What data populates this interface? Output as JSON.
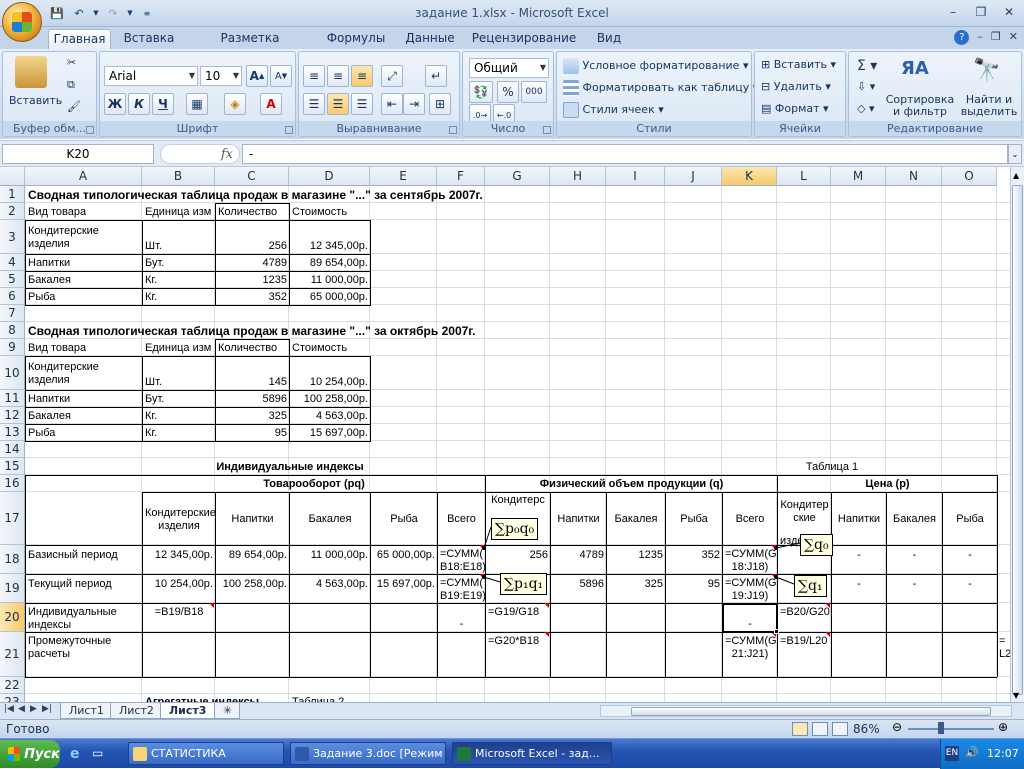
{
  "window": {
    "title": "задание 1.xlsx - Microsoft Excel"
  },
  "ribbon_tabs": [
    "Главная",
    "Вставка",
    "Разметка страницы",
    "Формулы",
    "Данные",
    "Рецензирование",
    "Вид"
  ],
  "ribbon": {
    "clipboard": {
      "paste": "Вставить",
      "label": "Буфер обм..."
    },
    "font": {
      "name": "Arial",
      "size": "10",
      "label": "Шрифт",
      "bold": "Ж",
      "italic": "К",
      "underline": "Ч"
    },
    "alignment": {
      "label": "Выравнивание"
    },
    "number": {
      "format": "Общий",
      "percent": "%",
      "thousands": "000",
      "label": "Число"
    },
    "styles": {
      "conditional": "Условное форматирование",
      "format_table": "Форматировать как таблицу",
      "cell_styles": "Стили ячеек",
      "label": "Стили"
    },
    "cells": {
      "insert": "Вставить",
      "delete": "Удалить",
      "format": "Формат",
      "label": "Ячейки"
    },
    "editing": {
      "sort": "Сортировка и фильтр",
      "find": "Найти и выделить",
      "label": "Редактирование"
    }
  },
  "formula_bar": {
    "name_box": "K20",
    "fx": "fx",
    "formula": "-"
  },
  "columns": [
    "A",
    "B",
    "C",
    "D",
    "E",
    "F",
    "G",
    "H",
    "I",
    "J",
    "K",
    "L",
    "M",
    "N",
    "O"
  ],
  "rows": [
    "1",
    "2",
    "3",
    "4",
    "5",
    "6",
    "7",
    "8",
    "9",
    "10",
    "11",
    "12",
    "13",
    "14",
    "15",
    "16",
    "17",
    "18",
    "19",
    "20",
    "21",
    "22",
    "23"
  ],
  "table_sep": {
    "title": "Сводная типологическая таблица продаж в магазине \"...\" за сентябрь 2007г.",
    "headers": [
      "Вид товара",
      "Единица изм",
      "Количество",
      "Стоимость"
    ],
    "rows": [
      {
        "name1": "Кондитерские",
        "name2": "изделия",
        "unit": "Шт.",
        "qty": "256",
        "cost": "12 345,00р."
      },
      {
        "name": "Напитки",
        "unit": "Бут.",
        "qty": "4789",
        "cost": "89 654,00р."
      },
      {
        "name": "Бакалея",
        "unit": "Кг.",
        "qty": "1235",
        "cost": "11 000,00р."
      },
      {
        "name": "Рыба",
        "unit": "Кг.",
        "qty": "352",
        "cost": "65 000,00р."
      }
    ]
  },
  "table_oct": {
    "title": "Сводная типологическая таблица продаж в магазине \"...\" за октябрь 2007г.",
    "headers": [
      "Вид товара",
      "Единица изм",
      "Количество",
      "Стоимость"
    ],
    "rows": [
      {
        "name1": "Кондитерские",
        "name2": "изделия",
        "unit": "Шт.",
        "qty": "145",
        "cost": "10 254,00р."
      },
      {
        "name": "Напитки",
        "unit": "Бут.",
        "qty": "5896",
        "cost": "100 258,00р."
      },
      {
        "name": "Бакалея",
        "unit": "Кг.",
        "qty": "325",
        "cost": "4 563,00р."
      },
      {
        "name": "Рыба",
        "unit": "Кг.",
        "qty": "95",
        "cost": "15 697,00р."
      }
    ]
  },
  "index_table": {
    "title": "Индивидуальные индексы",
    "table1": "Таблица 1",
    "turnover": "Товарооборот (pq)",
    "volume": "Физический объем продукции (q)",
    "price": "Цена (p)",
    "h17": {
      "b": "Кондитерские изделия",
      "c": "Напитки",
      "d": "Бакалея",
      "e": "Рыба",
      "f": "Всего",
      "g": "Кондитерс",
      "h": "Напитки",
      "i": "Бакалея",
      "j": "Рыба",
      "k": "Всего",
      "l": "Кондитерские",
      "m": "Напитки",
      "n": "Бакалея",
      "o": "Рыба"
    },
    "r18": {
      "a": "Базисный период",
      "b": "12 345,00р.",
      "c": "89 654,00р.",
      "d": "11 000,00р.",
      "e": "65 000,00р.",
      "f1": "=СУММ(",
      "f2": "B18:E18)",
      "g": "256",
      "h": "4789",
      "i": "1235",
      "j": "352",
      "k1": "=СУММ(G",
      "k2": "18:J18)",
      "l": "изде",
      "m": "-",
      "n": "-",
      "o": "-"
    },
    "r19": {
      "a": "Текущий период",
      "b": "10 254,00р.",
      "c": "100 258,00р.",
      "d": "4 563,00р.",
      "e": "15 697,00р.",
      "f1": "=СУММ(",
      "f2": "B19:E19)",
      "g": "",
      "h": "5896",
      "i": "325",
      "j": "95",
      "k1": "=СУММ(G",
      "k2": "19:J19)",
      "m": "-",
      "n": "-",
      "o": "-"
    },
    "r20": {
      "a1": "Индивидуальные",
      "a2": "индексы",
      "b": "=B19/B18",
      "f": "-",
      "g": "=G19/G18",
      "k": "-",
      "l": "=B20/G20"
    },
    "r21": {
      "a1": "Промежуточные",
      "a2": "расчеты",
      "g": "=G20*B18",
      "k1": "=СУММ(G",
      "k2": "21:J21)",
      "l": "=B19/L20",
      "o1": "=",
      "o2": "L2"
    },
    "r23": {
      "b": "Агрегатные индексы",
      "d": "Таблица 2"
    }
  },
  "callouts": {
    "p0q0": "∑p₀q₀",
    "p1q1": "∑p₁q₁",
    "q0": "∑q₀",
    "q1": "∑q₁"
  },
  "sheet_tabs": [
    "Лист1",
    "Лист2",
    "Лист3"
  ],
  "status": {
    "text": "Готово",
    "zoom": "86%"
  },
  "taskbar": {
    "start": "Пуск",
    "items": [
      "СТАТИСТИКА",
      "Задание 3.doc [Режим ...",
      "Microsoft Excel - зад..."
    ],
    "clock": "12:07",
    "lang": "EN"
  }
}
